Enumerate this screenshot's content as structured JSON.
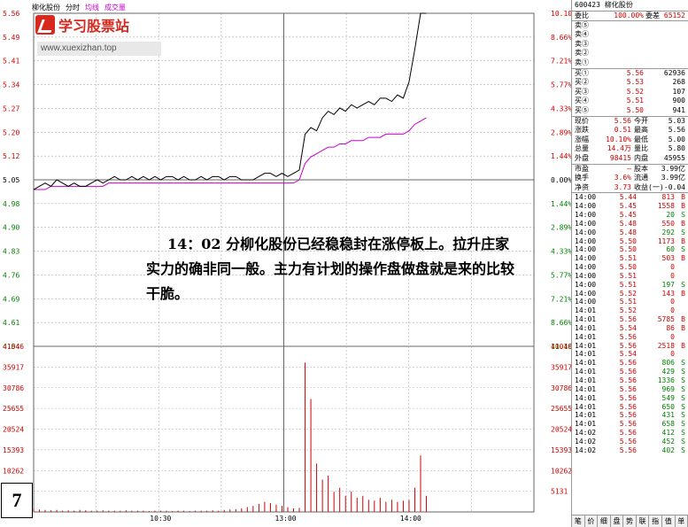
{
  "header": {
    "name": "柳化股份",
    "mode": "分时",
    "avg": "均线",
    "vol": "成交量"
  },
  "logo": {
    "text": "学习股票站",
    "url": "www.xuexizhan.top"
  },
  "note": "14：02 分柳化股份已经稳稳封在涨停板上。拉升庄家实力的确非同一般。主力有计划的操作盘做盘就是来的比较干脆。",
  "badge": "7",
  "chart_data": {
    "type": "line",
    "price_left_ticks": [
      "5.56",
      "5.49",
      "5.41",
      "5.34",
      "5.27",
      "5.20",
      "5.12",
      "5.05",
      "4.98",
      "4.90",
      "4.83",
      "4.76",
      "4.69",
      "4.61",
      "4.54"
    ],
    "price_right_ticks": [
      "10.10%",
      "8.66%",
      "7.21%",
      "5.77%",
      "4.33%",
      "2.89%",
      "1.44%",
      "0.00%",
      "1.44%",
      "2.89%",
      "4.33%",
      "5.77%",
      "7.21%",
      "8.66%",
      "10.10%"
    ],
    "vol_ticks": [
      "41046",
      "35917",
      "30786",
      "25655",
      "20524",
      "15393",
      "10262",
      "5131"
    ],
    "x_ticks": [
      "10:30",
      "13:00",
      "14:00"
    ],
    "prev_close": 5.05,
    "price": [
      5.02,
      5.03,
      5.04,
      5.03,
      5.05,
      5.04,
      5.03,
      5.04,
      5.03,
      5.03,
      5.04,
      5.05,
      5.04,
      5.05,
      5.06,
      5.05,
      5.05,
      5.06,
      5.05,
      5.06,
      5.05,
      5.06,
      5.05,
      5.06,
      5.06,
      5.05,
      5.06,
      5.05,
      5.05,
      5.06,
      5.05,
      5.06,
      5.06,
      5.05,
      5.06,
      5.06,
      5.05,
      5.05,
      5.05,
      5.06,
      5.07,
      5.07,
      5.06,
      5.07,
      5.06,
      5.07,
      5.08,
      5.19,
      5.21,
      5.2,
      5.24,
      5.26,
      5.25,
      5.27,
      5.26,
      5.28,
      5.27,
      5.28,
      5.29,
      5.28,
      5.3,
      5.3,
      5.29,
      5.31,
      5.3,
      5.35,
      5.45,
      5.56,
      5.56
    ],
    "avg": [
      5.02,
      5.02,
      5.02,
      5.03,
      5.03,
      5.03,
      5.03,
      5.03,
      5.03,
      5.03,
      5.03,
      5.03,
      5.03,
      5.04,
      5.04,
      5.04,
      5.04,
      5.04,
      5.04,
      5.04,
      5.04,
      5.04,
      5.04,
      5.04,
      5.04,
      5.04,
      5.04,
      5.04,
      5.04,
      5.04,
      5.04,
      5.04,
      5.04,
      5.04,
      5.04,
      5.04,
      5.04,
      5.04,
      5.04,
      5.04,
      5.04,
      5.04,
      5.04,
      5.04,
      5.04,
      5.04,
      5.05,
      5.1,
      5.12,
      5.13,
      5.14,
      5.15,
      5.15,
      5.16,
      5.16,
      5.17,
      5.17,
      5.17,
      5.18,
      5.18,
      5.18,
      5.19,
      5.19,
      5.19,
      5.19,
      5.2,
      5.22,
      5.23,
      5.24
    ],
    "volume": [
      800,
      600,
      500,
      400,
      500,
      300,
      400,
      300,
      500,
      400,
      300,
      300,
      400,
      300,
      300,
      300,
      400,
      300,
      300,
      300,
      200,
      300,
      300,
      300,
      200,
      300,
      300,
      200,
      300,
      300,
      300,
      400,
      300,
      500,
      600,
      700,
      900,
      1200,
      1500,
      2000,
      2500,
      2200,
      1800,
      1500,
      1200,
      900,
      1000,
      37000,
      28000,
      12000,
      8000,
      9000,
      5000,
      6000,
      4000,
      5000,
      3500,
      4000,
      3000,
      2800,
      3500,
      2500,
      3000,
      2500,
      2800,
      3000,
      6000,
      14000,
      4000
    ],
    "colors": {
      "price": "#000000",
      "avg": "#cc00cc",
      "volume": "#d00000",
      "grid": "#b0b0b0"
    }
  },
  "panel": {
    "code": "600423",
    "name": "柳化股份",
    "ratio": {
      "l1": "委比",
      "v1": "100.00%",
      "l2": "委差",
      "v2": "65152"
    },
    "sells": [
      {
        "label": "卖⑤",
        "price": "",
        "vol": ""
      },
      {
        "label": "卖④",
        "price": "",
        "vol": ""
      },
      {
        "label": "卖③",
        "price": "",
        "vol": ""
      },
      {
        "label": "卖②",
        "price": "",
        "vol": ""
      },
      {
        "label": "卖①",
        "price": "",
        "vol": ""
      }
    ],
    "buys": [
      {
        "label": "买①",
        "price": "5.56",
        "vol": "62936"
      },
      {
        "label": "买②",
        "price": "5.53",
        "vol": "268"
      },
      {
        "label": "买③",
        "price": "5.52",
        "vol": "107"
      },
      {
        "label": "买④",
        "price": "5.51",
        "vol": "900"
      },
      {
        "label": "买⑤",
        "price": "5.50",
        "vol": "941"
      }
    ],
    "stats": [
      {
        "l1": "现价",
        "v1": "5.56",
        "l2": "今开",
        "v2": "5.03"
      },
      {
        "l1": "涨跌",
        "v1": "0.51",
        "l2": "最高",
        "v2": "5.56"
      },
      {
        "l1": "涨幅",
        "v1": "10.10%",
        "l2": "最低",
        "v2": "5.00"
      },
      {
        "l1": "总量",
        "v1": "14.4万",
        "l2": "量比",
        "v2": "5.80"
      },
      {
        "l1": "外盘",
        "v1": "98415",
        "l2": "内盘",
        "v2": "45955"
      }
    ],
    "stats2": [
      {
        "l1": "市盈",
        "v1": "—",
        "l2": "股本",
        "v2": "3.99亿"
      },
      {
        "l1": "换手",
        "v1": "3.6%",
        "l2": "流通",
        "v2": "3.99亿"
      },
      {
        "l1": "净资",
        "v1": "3.73",
        "l2": "收益(一)",
        "v2": "-0.04"
      }
    ],
    "ticks": [
      {
        "t": "14:00",
        "p": "5.44",
        "v": "813",
        "f": "B"
      },
      {
        "t": "14:00",
        "p": "5.45",
        "v": "1558",
        "f": "B"
      },
      {
        "t": "14:00",
        "p": "5.45",
        "v": "20",
        "f": "S"
      },
      {
        "t": "14:00",
        "p": "5.48",
        "v": "550",
        "f": "B"
      },
      {
        "t": "14:00",
        "p": "5.48",
        "v": "292",
        "f": "S"
      },
      {
        "t": "14:00",
        "p": "5.50",
        "v": "1173",
        "f": "B"
      },
      {
        "t": "14:00",
        "p": "5.50",
        "v": "60",
        "f": "S"
      },
      {
        "t": "14:00",
        "p": "5.51",
        "v": "503",
        "f": "B"
      },
      {
        "t": "14:00",
        "p": "5.50",
        "v": "0",
        "f": ""
      },
      {
        "t": "14:00",
        "p": "5.51",
        "v": "0",
        "f": ""
      },
      {
        "t": "14:00",
        "p": "5.51",
        "v": "197",
        "f": "S"
      },
      {
        "t": "14:00",
        "p": "5.52",
        "v": "143",
        "f": "B"
      },
      {
        "t": "14:00",
        "p": "5.51",
        "v": "0",
        "f": ""
      },
      {
        "t": "14:01",
        "p": "5.52",
        "v": "0",
        "f": ""
      },
      {
        "t": "14:01",
        "p": "5.56",
        "v": "5785",
        "f": "B"
      },
      {
        "t": "14:01",
        "p": "5.54",
        "v": "86",
        "f": "B"
      },
      {
        "t": "14:01",
        "p": "5.56",
        "v": "0",
        "f": ""
      },
      {
        "t": "14:01",
        "p": "5.56",
        "v": "2518",
        "f": "B"
      },
      {
        "t": "14:01",
        "p": "5.54",
        "v": "0",
        "f": ""
      },
      {
        "t": "14:01",
        "p": "5.56",
        "v": "806",
        "f": "S"
      },
      {
        "t": "14:01",
        "p": "5.56",
        "v": "429",
        "f": "S"
      },
      {
        "t": "14:01",
        "p": "5.56",
        "v": "1336",
        "f": "S"
      },
      {
        "t": "14:01",
        "p": "5.56",
        "v": "969",
        "f": "S"
      },
      {
        "t": "14:01",
        "p": "5.56",
        "v": "549",
        "f": "S"
      },
      {
        "t": "14:01",
        "p": "5.56",
        "v": "650",
        "f": "S"
      },
      {
        "t": "14:01",
        "p": "5.56",
        "v": "431",
        "f": "S"
      },
      {
        "t": "14:01",
        "p": "5.56",
        "v": "658",
        "f": "S"
      },
      {
        "t": "14:02",
        "p": "5.56",
        "v": "412",
        "f": "S"
      },
      {
        "t": "14:02",
        "p": "5.56",
        "v": "452",
        "f": "S"
      },
      {
        "t": "14:02",
        "p": "5.56",
        "v": "402",
        "f": "S"
      }
    ],
    "tabs": [
      "笔",
      "价",
      "细",
      "盘",
      "势",
      "联",
      "指",
      "值",
      "单"
    ]
  }
}
